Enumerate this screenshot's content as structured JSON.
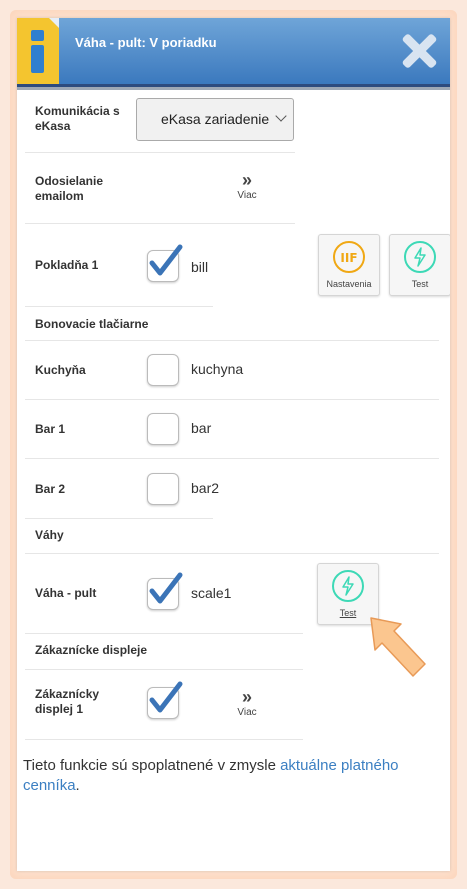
{
  "header": {
    "title": "Váha - pult: V poriadku"
  },
  "rows": {
    "komunikacia": {
      "label": "Komunikácia s eKasa",
      "select_value": "eKasa zariadenie"
    },
    "odosielanie": {
      "label": "Odosielanie emailom",
      "more_label": "Viac"
    },
    "pokladna": {
      "label": "Pokladňa 1",
      "checkbox_text": "bill",
      "tile1_label": "Nastavenia",
      "tile2_label": "Test"
    },
    "kuchyna": {
      "label": "Kuchyňa",
      "checkbox_text": "kuchyna"
    },
    "bar1": {
      "label": "Bar 1",
      "checkbox_text": "bar"
    },
    "bar2": {
      "label": "Bar 2",
      "checkbox_text": "bar2"
    },
    "vaha": {
      "label": "Váha - pult",
      "checkbox_text": "scale1",
      "tile_label": "Test"
    },
    "displej": {
      "label": "Zákaznícky displej 1",
      "more_label": "Viac"
    }
  },
  "sections": {
    "bonovacie": "Bonovacie tlačiarne",
    "vahy": "Váhy",
    "displeje": "Zákaznícke displeje"
  },
  "footer": {
    "text": "Tieto funkcie sú spoplatnené v zmysle ",
    "link": "aktuálne platného cenníka",
    "end": "."
  },
  "colors": {
    "header": "#3b79be",
    "info_icon_bg": "#f4c52f",
    "check": "#3b74b7",
    "settings_icon": "#f0a814",
    "test_icon": "#3dd9b6",
    "link": "#3b7fc2"
  }
}
